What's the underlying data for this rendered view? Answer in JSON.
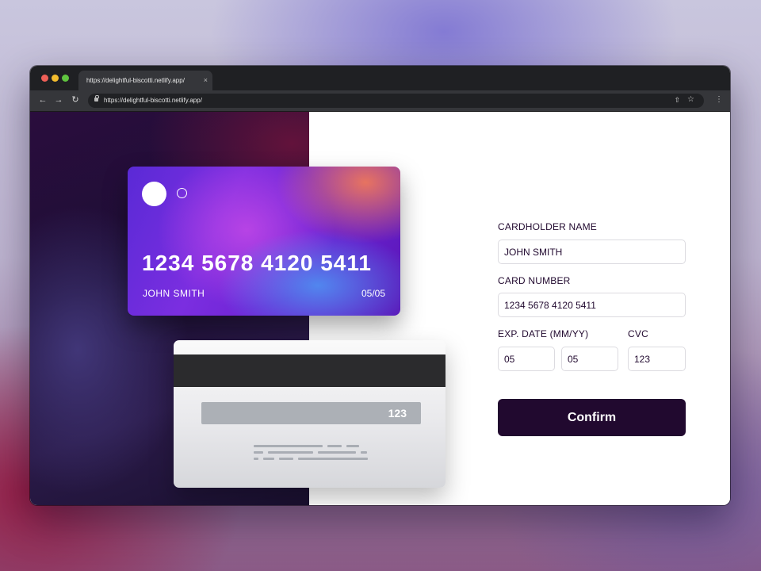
{
  "browser": {
    "tab_title": "https://delightful-biscotti.netlify.app/",
    "tab_close": "×",
    "url": "https://delightful-biscotti.netlify.app/",
    "icons": {
      "back": "left-arrow-icon",
      "forward": "right-arrow-icon",
      "reload": "reload-icon",
      "lock": "lock-icon",
      "share": "share-icon",
      "bookmark": "star-icon",
      "menu": "kebab-menu-icon"
    }
  },
  "card_front": {
    "number": "1234 5678 4120 5411",
    "holder": "JOHN SMITH",
    "expiry": "05/05"
  },
  "card_back": {
    "cvc": "123"
  },
  "form": {
    "name_label": "CARDHOLDER NAME",
    "name_value": "JOHN SMITH",
    "number_label": "CARD NUMBER",
    "number_value": "1234 5678 4120 5411",
    "exp_label": "EXP. DATE (MM/YY)",
    "exp_month": "05",
    "exp_year": "05",
    "cvc_label": "CVC",
    "cvc_value": "123",
    "confirm_label": "Confirm"
  },
  "colors": {
    "primary_dark": "#21092f",
    "browser_chrome": "#35363a",
    "input_border": "#dcdbe0"
  }
}
